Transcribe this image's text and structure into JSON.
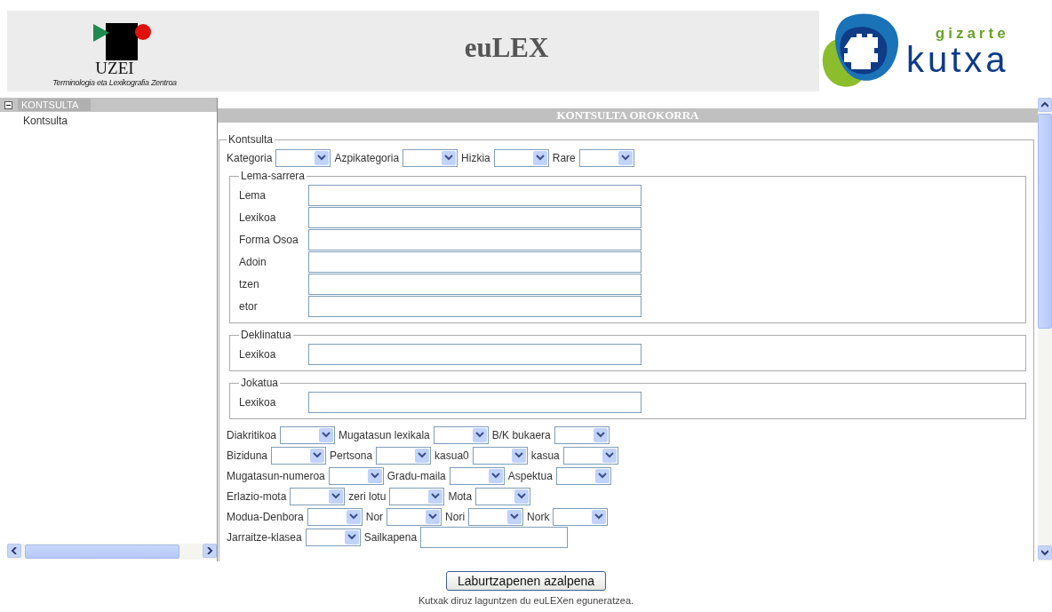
{
  "header": {
    "title": "euLEX",
    "left_logo": {
      "name": "UZEI",
      "subtitle": "Terminologia eta Lexikografia Zentroa"
    },
    "right_logo": {
      "top": "gizarte",
      "bottom": "kutxa"
    }
  },
  "sidebar": {
    "tree": [
      {
        "label": "KONTSULTA",
        "expanded": true,
        "selected": true,
        "children": [
          {
            "label": "Kontsulta",
            "selected": false
          }
        ]
      }
    ]
  },
  "main": {
    "heading": "KONTSULTA OROKORRA",
    "legend": "Kontsulta",
    "top_row": [
      {
        "label": "Kategoria",
        "kind": "select"
      },
      {
        "label": "Azpikategoria",
        "kind": "select"
      },
      {
        "label": "Hizkia",
        "kind": "select"
      },
      {
        "label": "Rare",
        "kind": "select"
      }
    ],
    "groups": [
      {
        "legend": "Lema-sarrera",
        "fields": [
          {
            "label": "Lema"
          },
          {
            "label": "Lexikoa"
          },
          {
            "label": "Forma Osoa"
          },
          {
            "label": "Adoin"
          },
          {
            "label": "tzen"
          },
          {
            "label": "etor"
          }
        ]
      },
      {
        "legend": "Deklinatua",
        "fields": [
          {
            "label": "Lexikoa"
          }
        ]
      },
      {
        "legend": "Jokatua",
        "fields": [
          {
            "label": "Lexikoa"
          }
        ]
      }
    ],
    "rows": [
      [
        {
          "label": "Diakritikoa",
          "kind": "select"
        },
        {
          "label": "Mugatasun lexikala",
          "kind": "select"
        },
        {
          "label": "B/K bukaera",
          "kind": "select"
        }
      ],
      [
        {
          "label": "Biziduna",
          "kind": "select"
        },
        {
          "label": "Pertsona",
          "kind": "select"
        },
        {
          "label": "kasua0",
          "kind": "select"
        },
        {
          "label": "kasua",
          "kind": "select"
        }
      ],
      [
        {
          "label": "Mugatasun-numeroa",
          "kind": "select"
        },
        {
          "label": "Gradu-maila",
          "kind": "select"
        },
        {
          "label": "Aspektua",
          "kind": "select"
        }
      ],
      [
        {
          "label": "Erlazio-mota",
          "kind": "select"
        },
        {
          "label": "zeri lotu",
          "kind": "select"
        },
        {
          "label": "Mota",
          "kind": "select"
        }
      ],
      [
        {
          "label": "Modua-Denbora",
          "kind": "select"
        },
        {
          "label": "Nor",
          "kind": "select"
        },
        {
          "label": "Nori",
          "kind": "select"
        },
        {
          "label": "Nork",
          "kind": "select"
        }
      ],
      [
        {
          "label": "Jarraitze-klasea",
          "kind": "select"
        },
        {
          "label": "Sailkapena",
          "kind": "text"
        }
      ]
    ]
  },
  "button": "Laburtzapenen azalpena",
  "footer": "Kutxak diruz laguntzen du euLEXen eguneratzea."
}
